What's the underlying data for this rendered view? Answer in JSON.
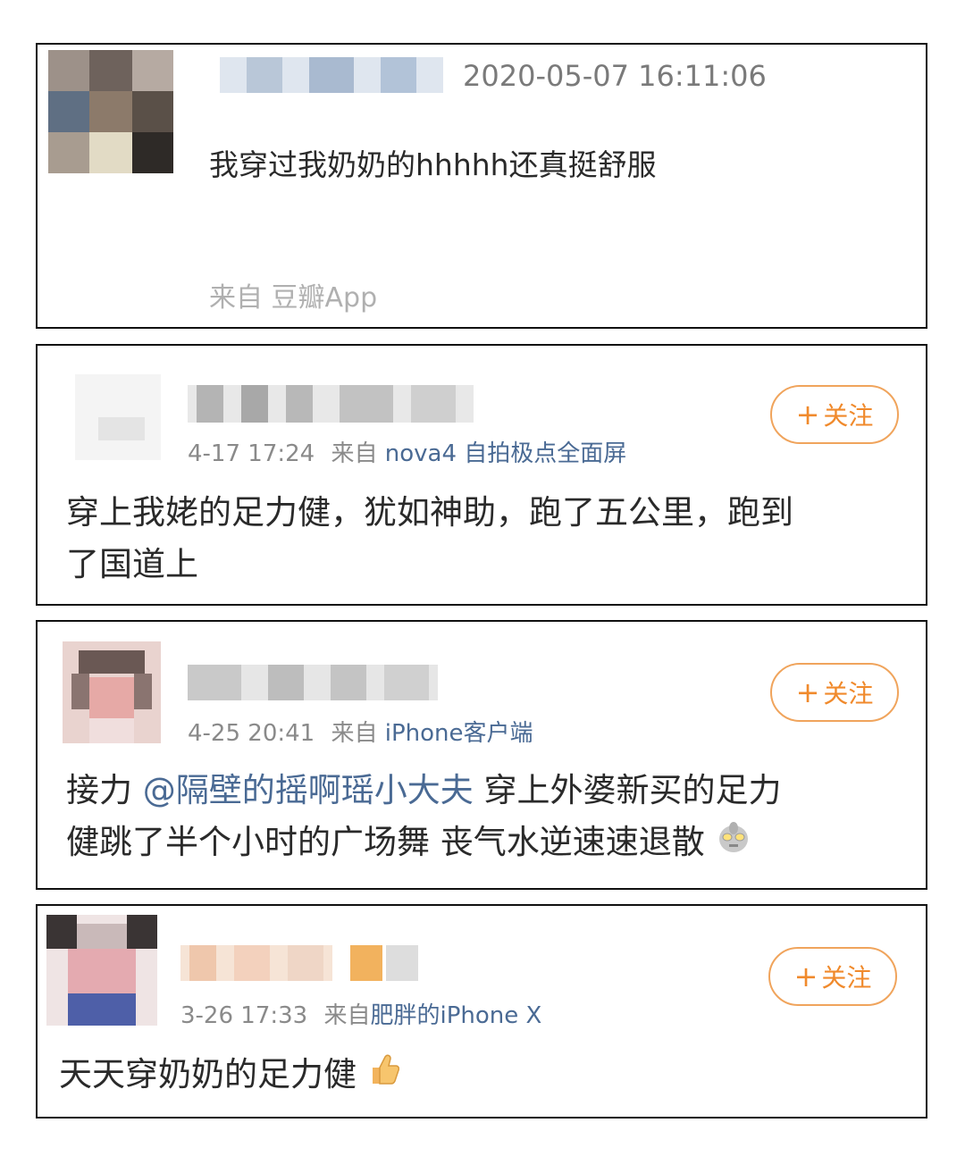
{
  "posts": [
    {
      "timestamp": "2020-05-07 16:11:06",
      "text": "我穿过我奶奶的hhhhh还真挺舒服",
      "source": "来自 豆瓣App"
    },
    {
      "meta_time": "4-17 17:24",
      "meta_from": "来自",
      "meta_device": "nova4 自拍极点全面屏",
      "follow_label": "关注",
      "text_line1": "穿上我姥的足力健，犹如神助，跑了五公里，跑到",
      "text_line2": "了国道上"
    },
    {
      "meta_time": "4-25 20:41",
      "meta_from": "来自",
      "meta_device": "iPhone客户端",
      "follow_label": "关注",
      "text_prefix": "接力 ",
      "mention": "@隔壁的摇啊瑶小大夫",
      "text_suffix": " 穿上外婆新买的足力",
      "text_line2": "健跳了半个小时的广场舞 丧气水逆速速退散",
      "emoji": "ultraman-emoji"
    },
    {
      "meta_time": "3-26 17:33",
      "meta_from": "来自",
      "meta_device": "肥胖的iPhone X",
      "follow_label": "关注",
      "text": "天天穿奶奶的足力健",
      "emoji": "thumbs-up-emoji"
    }
  ],
  "colors": {
    "accent_orange": "#f08a2c",
    "link_blue": "#4a6a94",
    "meta_gray": "#8a8a8a"
  }
}
